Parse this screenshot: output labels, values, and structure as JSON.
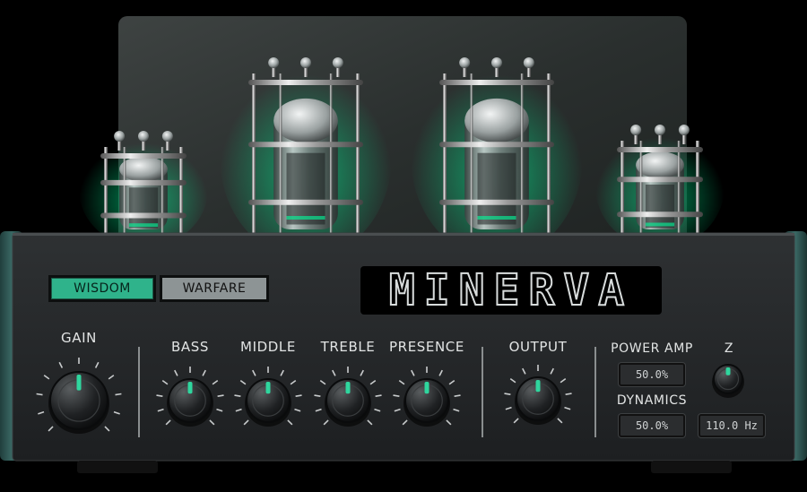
{
  "brand": {
    "logo_text": "MINERVA"
  },
  "modes": {
    "wisdom_label": "WISDOM",
    "warfare_label": "WARFARE",
    "active": "WISDOM"
  },
  "controls": {
    "gain_label": "GAIN",
    "bass_label": "BASS",
    "middle_label": "MIDDLE",
    "treble_label": "TREBLE",
    "presence_label": "PRESENCE",
    "output_label": "OUTPUT",
    "power_amp_label": "POWER AMP",
    "power_amp_value": "50.0%",
    "dynamics_label": "DYNAMICS",
    "dynamics_value": "50.0%",
    "z_label": "Z",
    "z_value": "110.0 Hz"
  },
  "colors": {
    "accent": "#2fb38b",
    "glow": "#00ff9c",
    "panel": "#26292b",
    "wood": "#2f5a58"
  },
  "icons": {
    "knob": "rotary-knob-icon",
    "tube": "vacuum-tube-icon"
  }
}
